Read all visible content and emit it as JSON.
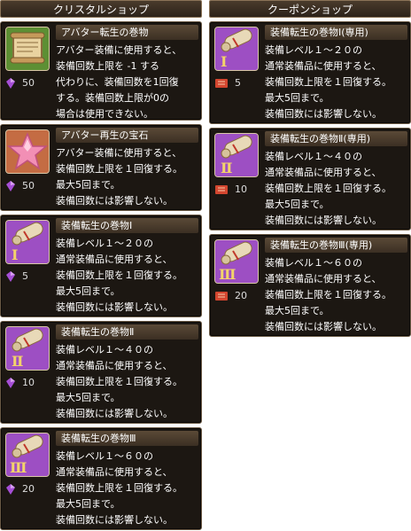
{
  "colors": {
    "accent": "#6b5a45",
    "crystal_price": "#a64fd6",
    "coupon_price": "#d3462f",
    "text": "#ffffff"
  },
  "crystal_shop": {
    "title": "クリスタルショップ",
    "items": [
      {
        "name": "アバター転生の巻物",
        "icon": "avatar-reincarnation-scroll-icon",
        "price": "50",
        "price_icon": "crystal-icon",
        "desc": [
          "アバター装備に使用すると、",
          "装備回数上限を -1 する",
          "代わりに、装備回数を1回復",
          "する。装備回数上限が0の",
          "場合は使用できない。"
        ]
      },
      {
        "name": "アバター再生の宝石",
        "icon": "pink-star-gem-icon",
        "price": "50",
        "price_icon": "crystal-icon",
        "desc": [
          "アバター装備に使用すると、",
          "装備回数上限を１回復する。",
          "最大5回まで。",
          "装備回数には影響しない。"
        ]
      },
      {
        "name": "装備転生の巻物Ⅰ",
        "icon": "scroll-I-icon",
        "price": "5",
        "price_icon": "crystal-icon",
        "desc": [
          "装備レベル１～２０の",
          "通常装備品に使用すると、",
          "装備回数上限を１回復する。",
          "最大5回まで。",
          "装備回数には影響しない。"
        ]
      },
      {
        "name": "装備転生の巻物Ⅱ",
        "icon": "scroll-II-icon",
        "price": "10",
        "price_icon": "crystal-icon",
        "desc": [
          "装備レベル１～４０の",
          "通常装備品に使用すると、",
          "装備回数上限を１回復する。",
          "最大5回まで。",
          "装備回数には影響しない。"
        ]
      },
      {
        "name": "装備転生の巻物Ⅲ",
        "icon": "scroll-III-icon",
        "price": "20",
        "price_icon": "crystal-icon",
        "desc": [
          "装備レベル１～６０の",
          "通常装備品に使用すると、",
          "装備回数上限を１回復する。",
          "最大5回まで。",
          "装備回数には影響しない。"
        ]
      }
    ]
  },
  "coupon_shop": {
    "title": "クーポンショップ",
    "items": [
      {
        "name": "装備転生の巻物Ⅰ(専用)",
        "icon": "scroll-I-icon",
        "price": "5",
        "price_icon": "coupon-icon",
        "desc": [
          "装備レベル１～２０の",
          "通常装備品に使用すると、",
          "装備回数上限を１回復する。",
          "最大5回まで。",
          "装備回数には影響しない。"
        ]
      },
      {
        "name": "装備転生の巻物Ⅱ(専用)",
        "icon": "scroll-II-icon",
        "price": "10",
        "price_icon": "coupon-icon",
        "desc": [
          "装備レベル１～４０の",
          "通常装備品に使用すると、",
          "装備回数上限を１回復する。",
          "最大5回まで。",
          "装備回数には影響しない。"
        ]
      },
      {
        "name": "装備転生の巻物Ⅲ(専用)",
        "icon": "scroll-III-icon",
        "price": "20",
        "price_icon": "coupon-icon",
        "desc": [
          "装備レベル１～６０の",
          "通常装備品に使用すると、",
          "装備回数上限を１回復する。",
          "最大5回まで。",
          "装備回数には影響しない。"
        ]
      }
    ]
  }
}
